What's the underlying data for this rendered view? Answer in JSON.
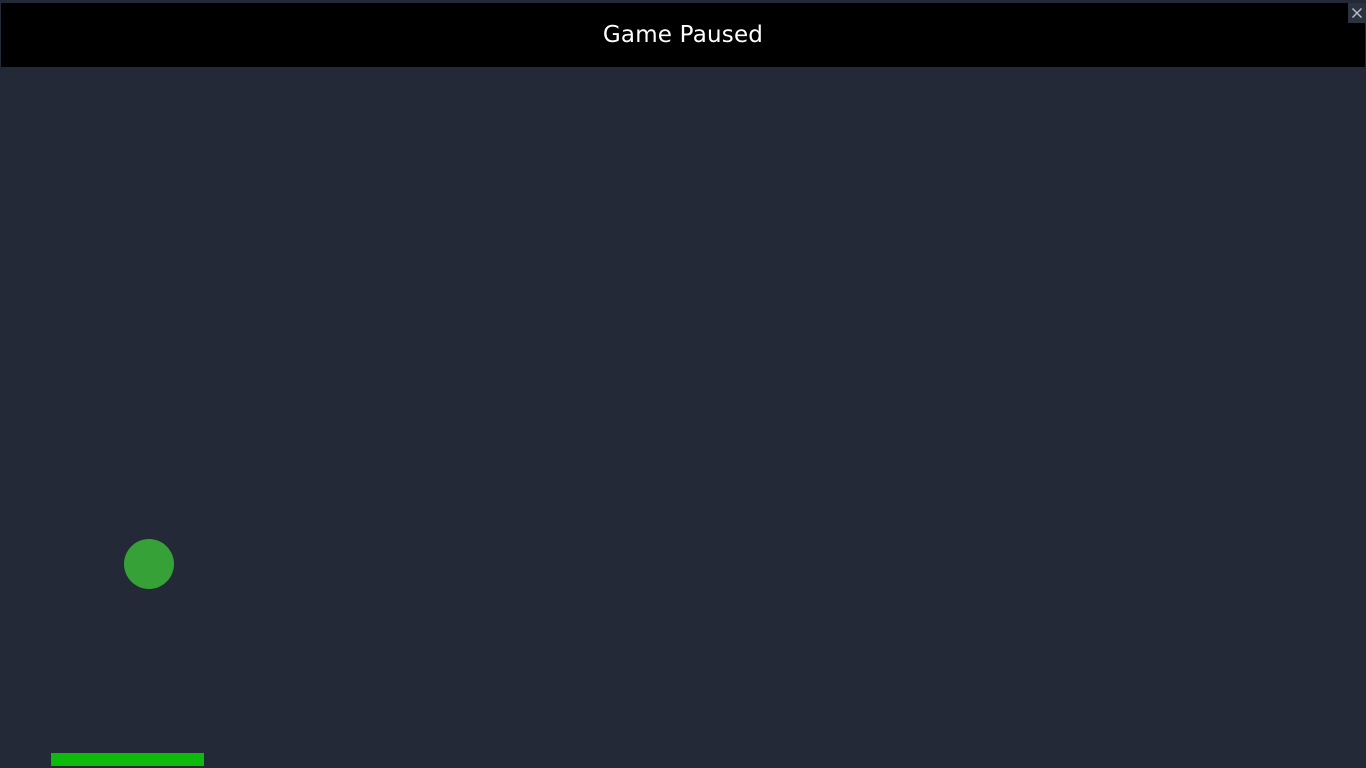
{
  "status": {
    "title": "Game Paused",
    "background_color": "#000000",
    "text_color": "#ffffff"
  },
  "close_button": {
    "icon": "close-icon",
    "label": "×"
  },
  "game": {
    "state": "paused",
    "background_color": "#232936",
    "ball": {
      "color": "#36a136"
    },
    "paddle": {
      "color": "#0dbb0d"
    }
  }
}
